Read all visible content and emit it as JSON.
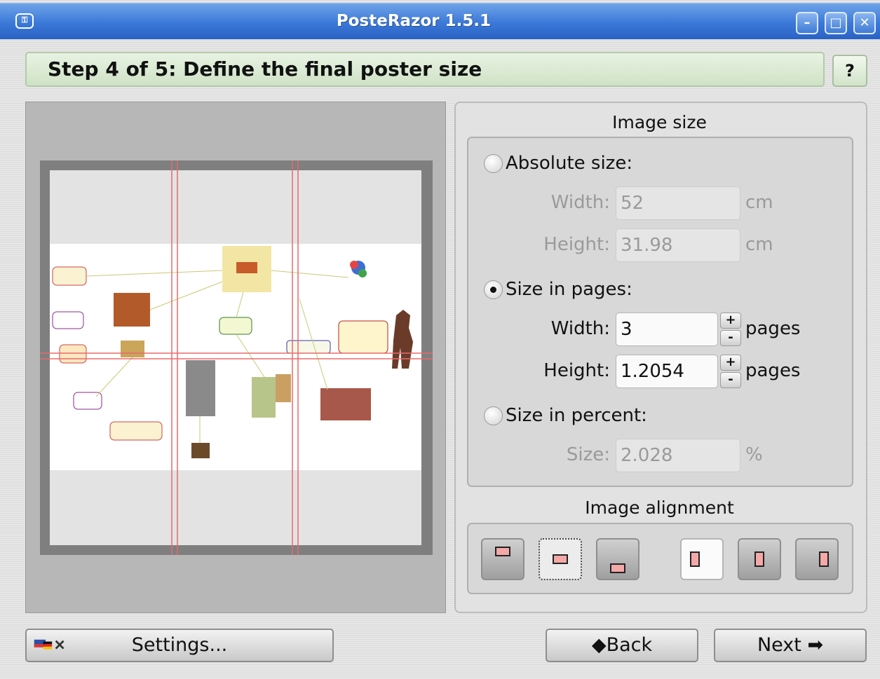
{
  "window": {
    "title": "PosteRazor 1.5.1",
    "icon": "app-icon",
    "controls": [
      "minimize-icon",
      "maximize-icon",
      "close-icon"
    ]
  },
  "step": {
    "title": "Step 4 of 5: Define the final poster size",
    "help_label": "?"
  },
  "image_size": {
    "group_title": "Image size",
    "absolute": {
      "label": "Absolute size:",
      "checked": false,
      "width_label": "Width:",
      "width_value": "52",
      "width_unit": "cm",
      "height_label": "Height:",
      "height_value": "31.98",
      "height_unit": "cm"
    },
    "pages": {
      "label": "Size in pages:",
      "checked": true,
      "width_label": "Width:",
      "width_value": "3",
      "width_unit": "pages",
      "height_label": "Height:",
      "height_value": "1.2054",
      "height_unit": "pages",
      "spin_up": "+",
      "spin_down": "-"
    },
    "percent": {
      "label": "Size in percent:",
      "checked": false,
      "size_label": "Size:",
      "size_value": "2.028",
      "size_unit": "%"
    }
  },
  "alignment": {
    "group_title": "Image alignment",
    "buttons": [
      "align-top",
      "align-center-vertical",
      "align-bottom",
      "align-left",
      "align-center-horizontal",
      "align-right"
    ],
    "selected": "align-center-vertical"
  },
  "footer": {
    "settings_label": "Settings...",
    "back_label": "Back",
    "next_label": "Next"
  },
  "colors": {
    "titlebar": "#3b78d8",
    "step_header": "#d8e8d0",
    "page_grid_line": "#e86a6a"
  }
}
